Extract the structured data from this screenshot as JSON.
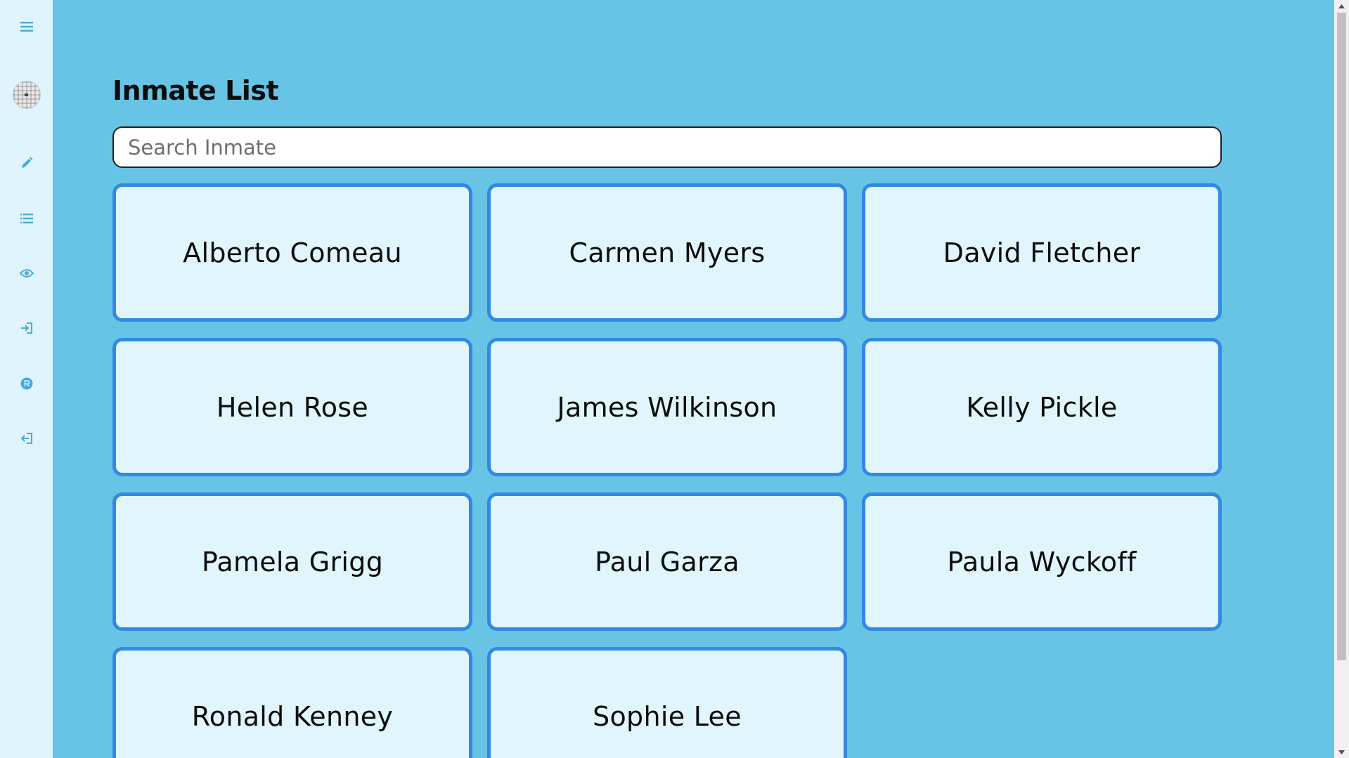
{
  "sidebar": {
    "items": [
      {
        "icon": "menu-icon",
        "id": "menu"
      },
      {
        "icon": "pencil-icon",
        "id": "edit"
      },
      {
        "icon": "list-icon",
        "id": "list"
      },
      {
        "icon": "eye-icon",
        "id": "view"
      },
      {
        "icon": "login-icon",
        "id": "login"
      },
      {
        "icon": "registered-icon",
        "id": "register"
      },
      {
        "icon": "logout-icon",
        "id": "logout"
      }
    ]
  },
  "main": {
    "title": "Inmate List",
    "search": {
      "placeholder": "Search Inmate",
      "value": ""
    },
    "inmates": [
      "Alberto Comeau",
      "Carmen Myers",
      "David Fletcher",
      "Helen Rose",
      "James Wilkinson",
      "Kelly Pickle",
      "Pamela Grigg",
      "Paul Garza",
      "Paula Wyckoff",
      "Ronald Kenney",
      "Sophie Lee"
    ]
  },
  "colors": {
    "page_background": "#68c4e4",
    "sidebar_background": "#dff4fc",
    "sidebar_icon": "#4aa9d8",
    "card_background": "#e0f5fc",
    "card_border": "#3388e6"
  }
}
